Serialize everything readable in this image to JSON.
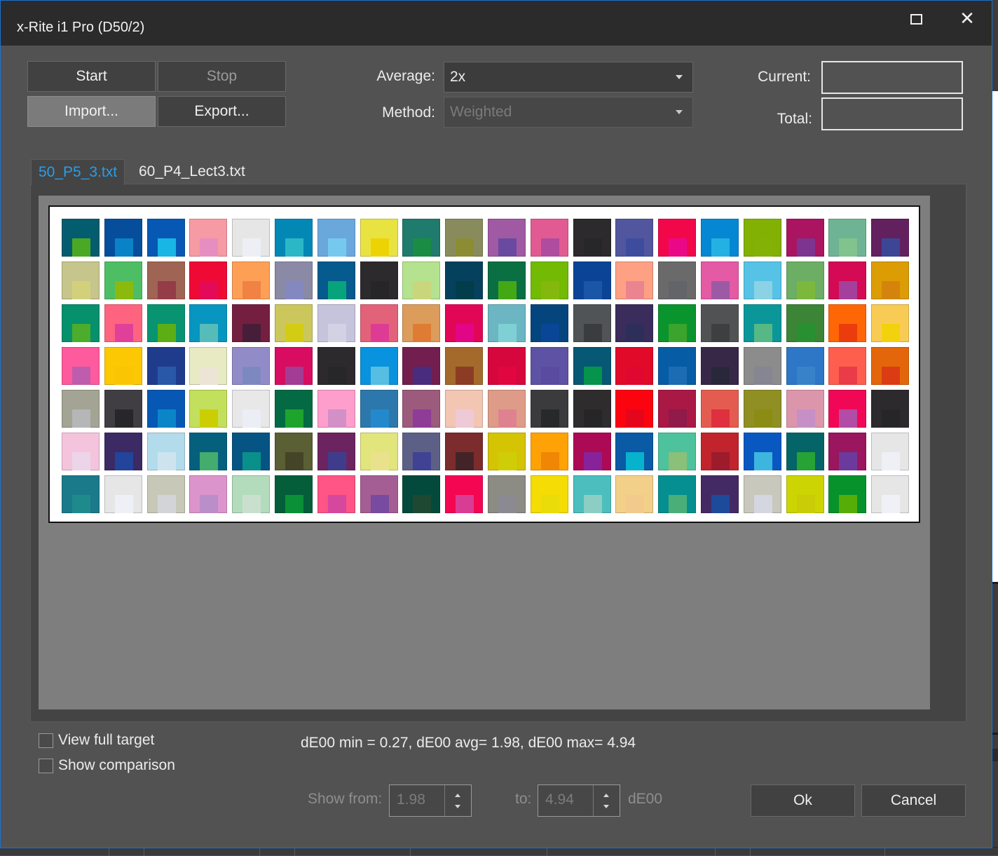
{
  "window": {
    "title": "x-Rite i1 Pro (D50/2)",
    "maximize_icon": "maximize-icon",
    "close_icon": "close-icon",
    "close_glyph": "✕"
  },
  "toolbar": {
    "start_label": "Start",
    "stop_label": "Stop",
    "import_label": "Import...",
    "export_label": "Export..."
  },
  "settings": {
    "average_label": "Average:",
    "average_value": "2x",
    "method_label": "Method:",
    "method_value": "Weighted"
  },
  "progress": {
    "current_label": "Current:",
    "current_value": "",
    "total_label": "Total:",
    "total_value": ""
  },
  "tabs": [
    {
      "label": "50_P5_3.txt",
      "active": true
    },
    {
      "label": "60_P4_Lect3.txt",
      "active": false
    }
  ],
  "colors": {
    "accent": "#2a9de8",
    "window_border": "#1e6fd1",
    "titlebar": "#2b2b2b",
    "dialog_bg": "#525252"
  },
  "target_patches": [
    [
      [
        "#045d6e",
        "#4aa825"
      ],
      [
        "#064e9c",
        "#0a82c8"
      ],
      [
        "#0658b4",
        "#17b6e4"
      ],
      [
        "#f69aa4",
        "#e78ec0"
      ],
      [
        "#e6e6e6",
        "#edeff5"
      ],
      [
        "#0388b6",
        "#2cb7c6"
      ],
      [
        "#6aa8dc",
        "#75c9ef"
      ],
      [
        "#e9e342",
        "#ecd404"
      ],
      [
        "#1f7b6c",
        "#1a8c44"
      ],
      [
        "#888c5c",
        "#8c8c34"
      ],
      [
        "#a05aa4",
        "#6a4aa0"
      ],
      [
        "#e25a92",
        "#b04ca0"
      ],
      [
        "#2c2a2c",
        "#272729"
      ],
      [
        "#52569e",
        "#3e4c9e"
      ],
      [
        "#f2074a",
        "#ea0888"
      ],
      [
        "#0587d4",
        "#23b1e4"
      ],
      [
        "#82b104",
        "#84b105"
      ],
      [
        "#aa1460",
        "#7c3490"
      ],
      [
        "#6eb494",
        "#82c28c"
      ],
      [
        "#63205f",
        "#3c4694"
      ]
    ],
    [
      [
        "#c6c58c",
        "#d3d07c"
      ],
      [
        "#4ebe64",
        "#8aba0e"
      ],
      [
        "#a06454",
        "#943c48"
      ],
      [
        "#ee0a34",
        "#e40a58"
      ],
      [
        "#fda056",
        "#f08244"
      ],
      [
        "#8a8aa6",
        "#8488c0"
      ],
      [
        "#055a8e",
        "#07a47c"
      ],
      [
        "#2c2a2c",
        "#262629"
      ],
      [
        "#b4e28e",
        "#cad67c"
      ],
      [
        "#05415c",
        "#033c4a"
      ],
      [
        "#0a7044",
        "#44a814"
      ],
      [
        "#72ba04",
        "#84b80c"
      ],
      [
        "#0b4496",
        "#1a56a6"
      ],
      [
        "#fea084",
        "#ec8490"
      ],
      [
        "#6a6a6a",
        "#626469"
      ],
      [
        "#e45aa4",
        "#9c5aa4"
      ],
      [
        "#56c2e6",
        "#8ad2e4"
      ],
      [
        "#6cae64",
        "#7cb83c"
      ],
      [
        "#d40a54",
        "#a4409c"
      ],
      [
        "#dc9c04",
        "#d4840c"
      ]
    ],
    [
      [
        "#06906c",
        "#4cac2c"
      ],
      [
        "#fe6480",
        "#e0409a"
      ],
      [
        "#089470",
        "#5cae14"
      ],
      [
        "#0696c0",
        "#56bcba"
      ],
      [
        "#741f40",
        "#461e3a"
      ],
      [
        "#cbc75c",
        "#d3cc14"
      ],
      [
        "#c6c4dd",
        "#d2d2e4"
      ],
      [
        "#e2627a",
        "#de3c94"
      ],
      [
        "#dc9c5c",
        "#df7c34"
      ],
      [
        "#e20656",
        "#e20686"
      ],
      [
        "#6cb6c4",
        "#7ed0d4"
      ],
      [
        "#05457e",
        "#094696"
      ],
      [
        "#505456",
        "#3b3c3f"
      ],
      [
        "#3a2d5c",
        "#2e2e5a"
      ],
      [
        "#0a942e",
        "#3aa42c"
      ],
      [
        "#505254",
        "#3e3f42"
      ],
      [
        "#0b969a",
        "#56b884"
      ],
      [
        "#3c8436",
        "#289030"
      ],
      [
        "#ff6606",
        "#ea3c0c"
      ],
      [
        "#f8cc54",
        "#f2d20c"
      ]
    ],
    [
      [
        "#fe5a9e",
        "#c05cae"
      ],
      [
        "#fcc804",
        "#fac604"
      ],
      [
        "#1f3c8c",
        "#2a58a8"
      ],
      [
        "#e8eac4",
        "#ece4d4"
      ],
      [
        "#918cc8",
        "#7e88c0"
      ],
      [
        "#d80c60",
        "#a23c94"
      ],
      [
        "#2c2a2c",
        "#272729"
      ],
      [
        "#0992de",
        "#56bee2"
      ],
      [
        "#721e4e",
        "#492c7e"
      ],
      [
        "#a46a2c",
        "#8c3c24"
      ],
      [
        "#d6073c",
        "#e10540"
      ],
      [
        "#5e52a4",
        "#5a4aa0"
      ],
      [
        "#065874",
        "#06944c"
      ],
      [
        "#e10a28",
        "#e00830"
      ],
      [
        "#075ca6",
        "#1c6cb4"
      ],
      [
        "#372848",
        "#29283a"
      ],
      [
        "#8c8c8c",
        "#858692"
      ],
      [
        "#2e76c6",
        "#3882ca"
      ],
      [
        "#fe5e4e",
        "#ea3c48"
      ],
      [
        "#e4660a",
        "#dc3c14"
      ]
    ],
    [
      [
        "#a4a494",
        "#b4b6b8"
      ],
      [
        "#403e42",
        "#272729"
      ],
      [
        "#0658b4",
        "#0a86c8"
      ],
      [
        "#c3e05c",
        "#ccce04"
      ],
      [
        "#e8e8e8",
        "#eceef5"
      ],
      [
        "#046a44",
        "#1ea42c"
      ],
      [
        "#fd9ecd",
        "#d290c6"
      ],
      [
        "#2c78ac",
        "#2488cc"
      ],
      [
        "#9c5a7c",
        "#8e3c98"
      ],
      [
        "#f2c6b2",
        "#eecad6"
      ],
      [
        "#de9c88",
        "#de8290"
      ],
      [
        "#3b3b3e",
        "#28292b"
      ],
      [
        "#2f2c2e",
        "#262628"
      ],
      [
        "#fb0410",
        "#e6061c"
      ],
      [
        "#aa1846",
        "#901a4a"
      ],
      [
        "#e45c50",
        "#de303e"
      ],
      [
        "#908f24",
        "#8a8c14"
      ],
      [
        "#dc96ac",
        "#c690c6"
      ],
      [
        "#f00856",
        "#b24ca6"
      ],
      [
        "#2c2a2c",
        "#262628"
      ]
    ],
    [
      [
        "#f4c4dc",
        "#ecd4e9"
      ],
      [
        "#3b2a64",
        "#22449a"
      ],
      [
        "#b2dcec",
        "#cde4ee"
      ],
      [
        "#05607e",
        "#44ac6c"
      ],
      [
        "#055484",
        "#09908a"
      ],
      [
        "#5a5f34",
        "#444528"
      ],
      [
        "#6c2460",
        "#403c8c"
      ],
      [
        "#e2e47c",
        "#eae18c"
      ],
      [
        "#5d6086",
        "#404294"
      ],
      [
        "#7c2c2c",
        "#422428"
      ],
      [
        "#d4c404",
        "#cfce06"
      ],
      [
        "#fea205",
        "#f08604"
      ],
      [
        "#ac0a54",
        "#88229a"
      ],
      [
        "#0a5aa6",
        "#06b2cc"
      ],
      [
        "#4ec29c",
        "#8ac078"
      ],
      [
        "#c1242c",
        "#9c1c2c"
      ],
      [
        "#0958c2",
        "#3cb6de"
      ],
      [
        "#056468",
        "#27a234"
      ],
      [
        "#9a165e",
        "#6c3a9c"
      ],
      [
        "#e6e6e6",
        "#eff0f6"
      ]
    ],
    [
      [
        "#1b7a8a",
        "#1f8a8c"
      ],
      [
        "#e6e6e6",
        "#eef0f6"
      ],
      [
        "#c8c8b8",
        "#d2d4d8"
      ],
      [
        "#dc94cc",
        "#ba8ec8"
      ],
      [
        "#b2dcbc",
        "#c9e0cf"
      ],
      [
        "#045e3a",
        "#0a9036"
      ],
      [
        "#fe5486",
        "#d6479e"
      ],
      [
        "#a45e94",
        "#784aa0"
      ],
      [
        "#034a3c",
        "#1f4832"
      ],
      [
        "#f40653",
        "#d93c93"
      ],
      [
        "#8c8c84",
        "#8b8a92"
      ],
      [
        "#f4dc04",
        "#e9dc08"
      ],
      [
        "#4cbebe",
        "#8ccec4"
      ],
      [
        "#f3d08a",
        "#f2ca8c"
      ],
      [
        "#058f90",
        "#4aae78"
      ],
      [
        "#442a64",
        "#1e4a9c"
      ],
      [
        "#c8c8bc",
        "#d4d6e0"
      ],
      [
        "#ccd404",
        "#c9cc06"
      ],
      [
        "#07922c",
        "#57ad08"
      ],
      [
        "#e6e6e6",
        "#f0f1f6"
      ]
    ]
  ],
  "options": {
    "view_full_target_label": "View full target",
    "show_comparison_label": "Show comparison"
  },
  "stats_text": "dE00 min = 0.27, dE00 avg= 1.98, dE00 max= 4.94",
  "filter": {
    "show_from_label": "Show from:",
    "from_value": "1.98",
    "to_label": "to:",
    "to_value": "4.94",
    "unit": "dE00"
  },
  "footer": {
    "ok_label": "Ok",
    "cancel_label": "Cancel"
  }
}
